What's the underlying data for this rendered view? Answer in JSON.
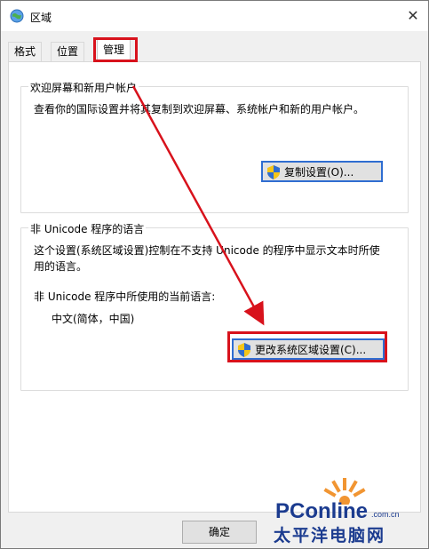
{
  "window": {
    "title": "区域",
    "close_glyph": "✕"
  },
  "tabs": [
    {
      "label": "格式"
    },
    {
      "label": "位置"
    },
    {
      "label": "管理",
      "active": true
    }
  ],
  "welcome_group": {
    "label": "欢迎屏幕和新用户帐户",
    "description": "查看你的国际设置并将其复制到欢迎屏幕、系统帐户和新的用户帐户。",
    "copy_button": "复制设置(O)..."
  },
  "unicode_group": {
    "label": "非 Unicode 程序的语言",
    "description_line1": "这个设置(系统区域设置)控制在不支持 Unicode 的程序中显示文本时所使",
    "description_line2": "用的语言。",
    "current_label": "非 Unicode 程序中所使用的当前语言:",
    "current_value": "中文(简体，中国)",
    "change_button": "更改系统区域设置(C)..."
  },
  "footer": {
    "ok_button": "确定"
  },
  "watermark": {
    "brand": "PConline",
    "domain": ".com.cn",
    "cn_name": "太平洋电脑网"
  },
  "colors": {
    "highlight": "#d8121c",
    "accent_blue": "#2f6dd1",
    "watermark_blue": "#1b3b8f",
    "watermark_orange": "#f08a1c"
  },
  "icons": [
    "region-globe-icon",
    "close-icon",
    "uac-shield-icon",
    "arrow-annotation-icon",
    "pconline-logo-icon"
  ]
}
